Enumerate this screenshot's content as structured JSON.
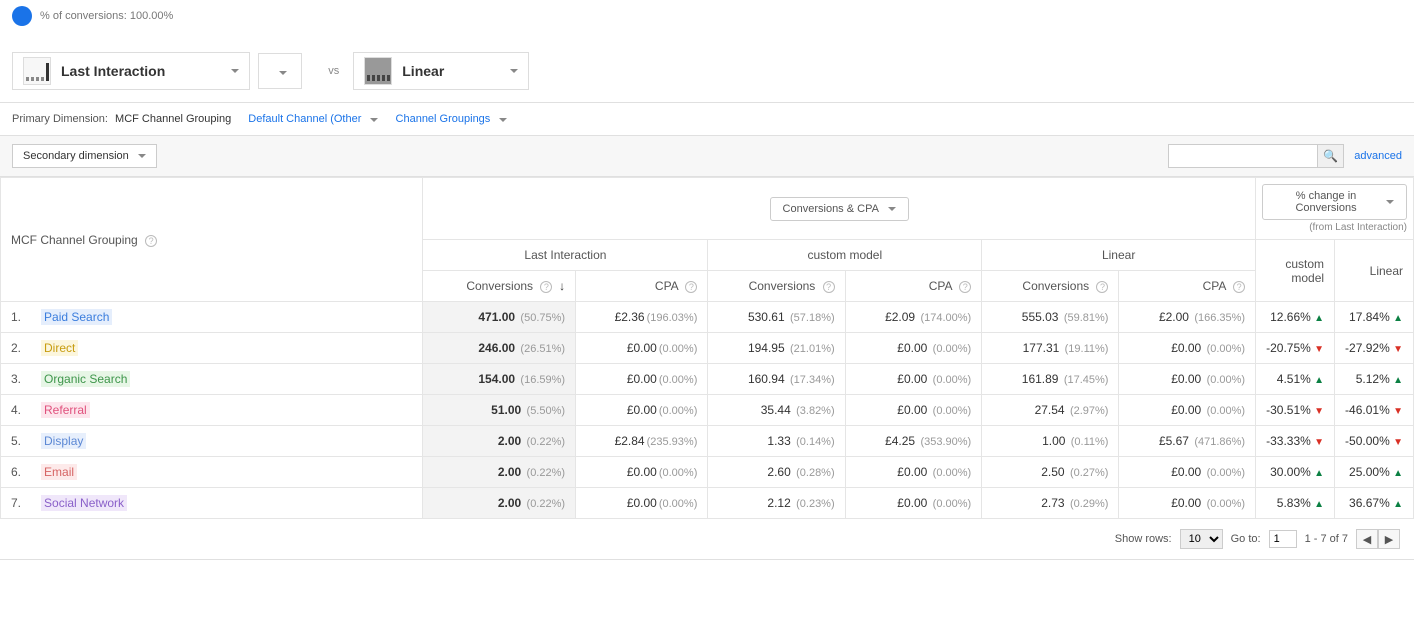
{
  "header": {
    "conversions_pct_label": "% of conversions: 100.00%"
  },
  "models": {
    "left": "Last Interaction",
    "vs": "vs",
    "right": "Linear"
  },
  "dimension": {
    "label": "Primary Dimension:",
    "active": "MCF Channel Grouping",
    "opt1": "Default Channel (Other",
    "opt2": "Channel Groupings"
  },
  "toolbar": {
    "secondary": "Secondary dimension",
    "advanced": "advanced"
  },
  "table": {
    "title_col": "MCF Channel Grouping",
    "metric_pill": "Conversions & CPA",
    "change_pill": "% change in Conversions",
    "change_sub": "(from Last Interaction)",
    "group1": "Last Interaction",
    "group2": "custom model",
    "group3": "Linear",
    "sub_conv": "Conversions",
    "sub_cpa": "CPA",
    "change_col1": "custom model",
    "change_col2": "Linear"
  },
  "rows": [
    {
      "idx": "1.",
      "name": "Paid Search",
      "cls": "tag-paid",
      "c1": "471.00",
      "c1p": "(50.75%)",
      "cpa1": "£2.36",
      "cpa1p": "(196.03%)",
      "c2": "530.61",
      "c2p": "(57.18%)",
      "cpa2": "£2.09",
      "cpa2p": "(174.00%)",
      "c3": "555.03",
      "c3p": "(59.81%)",
      "cpa3": "£2.00",
      "cpa3p": "(166.35%)",
      "chg1": "12.66%",
      "d1": "up",
      "chg2": "17.84%",
      "d2": "up"
    },
    {
      "idx": "2.",
      "name": "Direct",
      "cls": "tag-direct",
      "c1": "246.00",
      "c1p": "(26.51%)",
      "cpa1": "£0.00",
      "cpa1p": "(0.00%)",
      "c2": "194.95",
      "c2p": "(21.01%)",
      "cpa2": "£0.00",
      "cpa2p": "(0.00%)",
      "c3": "177.31",
      "c3p": "(19.11%)",
      "cpa3": "£0.00",
      "cpa3p": "(0.00%)",
      "chg1": "-20.75%",
      "d1": "down",
      "chg2": "-27.92%",
      "d2": "down"
    },
    {
      "idx": "3.",
      "name": "Organic Search",
      "cls": "tag-organic",
      "c1": "154.00",
      "c1p": "(16.59%)",
      "cpa1": "£0.00",
      "cpa1p": "(0.00%)",
      "c2": "160.94",
      "c2p": "(17.34%)",
      "cpa2": "£0.00",
      "cpa2p": "(0.00%)",
      "c3": "161.89",
      "c3p": "(17.45%)",
      "cpa3": "£0.00",
      "cpa3p": "(0.00%)",
      "chg1": "4.51%",
      "d1": "up",
      "chg2": "5.12%",
      "d2": "up"
    },
    {
      "idx": "4.",
      "name": "Referral",
      "cls": "tag-referral",
      "c1": "51.00",
      "c1p": "(5.50%)",
      "cpa1": "£0.00",
      "cpa1p": "(0.00%)",
      "c2": "35.44",
      "c2p": "(3.82%)",
      "cpa2": "£0.00",
      "cpa2p": "(0.00%)",
      "c3": "27.54",
      "c3p": "(2.97%)",
      "cpa3": "£0.00",
      "cpa3p": "(0.00%)",
      "chg1": "-30.51%",
      "d1": "down",
      "chg2": "-46.01%",
      "d2": "down"
    },
    {
      "idx": "5.",
      "name": "Display",
      "cls": "tag-display",
      "c1": "2.00",
      "c1p": "(0.22%)",
      "cpa1": "£2.84",
      "cpa1p": "(235.93%)",
      "c2": "1.33",
      "c2p": "(0.14%)",
      "cpa2": "£4.25",
      "cpa2p": "(353.90%)",
      "c3": "1.00",
      "c3p": "(0.11%)",
      "cpa3": "£5.67",
      "cpa3p": "(471.86%)",
      "chg1": "-33.33%",
      "d1": "down",
      "chg2": "-50.00%",
      "d2": "down"
    },
    {
      "idx": "6.",
      "name": "Email",
      "cls": "tag-email",
      "c1": "2.00",
      "c1p": "(0.22%)",
      "cpa1": "£0.00",
      "cpa1p": "(0.00%)",
      "c2": "2.60",
      "c2p": "(0.28%)",
      "cpa2": "£0.00",
      "cpa2p": "(0.00%)",
      "c3": "2.50",
      "c3p": "(0.27%)",
      "cpa3": "£0.00",
      "cpa3p": "(0.00%)",
      "chg1": "30.00%",
      "d1": "up",
      "chg2": "25.00%",
      "d2": "up"
    },
    {
      "idx": "7.",
      "name": "Social Network",
      "cls": "tag-social",
      "c1": "2.00",
      "c1p": "(0.22%)",
      "cpa1": "£0.00",
      "cpa1p": "(0.00%)",
      "c2": "2.12",
      "c2p": "(0.23%)",
      "cpa2": "£0.00",
      "cpa2p": "(0.00%)",
      "c3": "2.73",
      "c3p": "(0.29%)",
      "cpa3": "£0.00",
      "cpa3p": "(0.00%)",
      "chg1": "5.83%",
      "d1": "up",
      "chg2": "36.67%",
      "d2": "up"
    }
  ],
  "footer": {
    "show_rows": "Show rows:",
    "rows_val": "10",
    "goto": "Go to:",
    "goto_val": "1",
    "range": "1 - 7 of 7"
  }
}
